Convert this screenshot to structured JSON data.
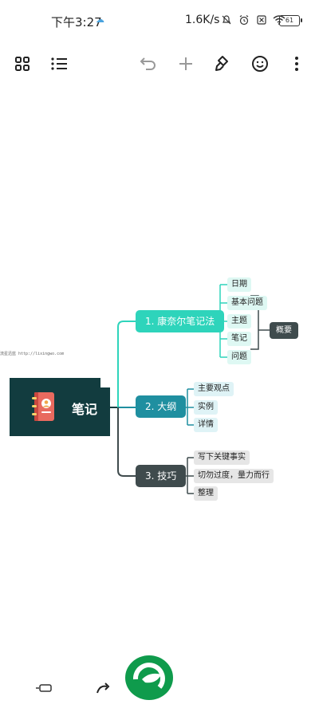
{
  "status_bar": {
    "time": "下午3:27",
    "cloud": "☁",
    "speed": "1.6K/s",
    "battery": "61"
  },
  "toolbar": {
    "icons": [
      "grid-icon",
      "list-icon",
      "undo-icon",
      "add-icon",
      "brush-icon",
      "emoji-icon",
      "more-icon"
    ]
  },
  "mindmap": {
    "root": "笔记",
    "branches": [
      {
        "label": "1. 康奈尔笔记法",
        "children": [
          "日期",
          "基本问题",
          "主题",
          "笔记",
          "问题"
        ]
      },
      {
        "label": "2. 大纲",
        "children": [
          "主要观点",
          "实例",
          "详情"
        ]
      },
      {
        "label": "3. 技巧",
        "children": [
          "写下关键事实",
          "切勿过度，量力而行",
          "整理"
        ]
      }
    ],
    "summary": "概要"
  },
  "watermark": "流星迅蓝 http://lixingwo.com",
  "colors": {
    "root": "#123c3f",
    "branch1": "#2ed4bb",
    "branch2": "#1f8fa0",
    "branch3": "#3f4b4d",
    "logo": "#0f9b4c"
  }
}
